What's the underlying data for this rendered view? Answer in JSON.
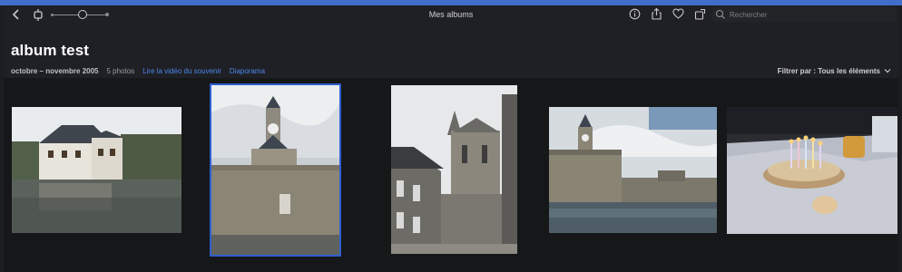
{
  "window": {
    "title": "Mes albums"
  },
  "toolbar": {
    "back_icon": "chevron-left-icon",
    "rotate_icon": "rotate-icon",
    "zoom_icon": "zoom-slider",
    "info_icon": "info-icon",
    "share_icon": "share-icon",
    "favorite_icon": "heart-icon",
    "export_icon": "rotate-export-icon"
  },
  "search": {
    "placeholder": "Rechercher",
    "value": ""
  },
  "album": {
    "title": "album test",
    "dates": "octobre – novembre 2005",
    "count": "5 photos",
    "memory_link": "Lire la vidéo du souvenir",
    "slideshow_link": "Diaporama"
  },
  "filter": {
    "label": "Filtrer par : Tous les éléments"
  },
  "photos": [
    {
      "subject": "manor house by the water",
      "selected": false
    },
    {
      "subject": "clock tower and ramparts",
      "selected": true
    },
    {
      "subject": "church tower above street",
      "selected": false
    },
    {
      "subject": "harbor with clock tower",
      "selected": false
    },
    {
      "subject": "birthday cake with candles",
      "selected": false
    }
  ],
  "colors": {
    "accent": "#2f5fd0",
    "link": "#4a86e8",
    "topbar": "#3f6fc9"
  }
}
